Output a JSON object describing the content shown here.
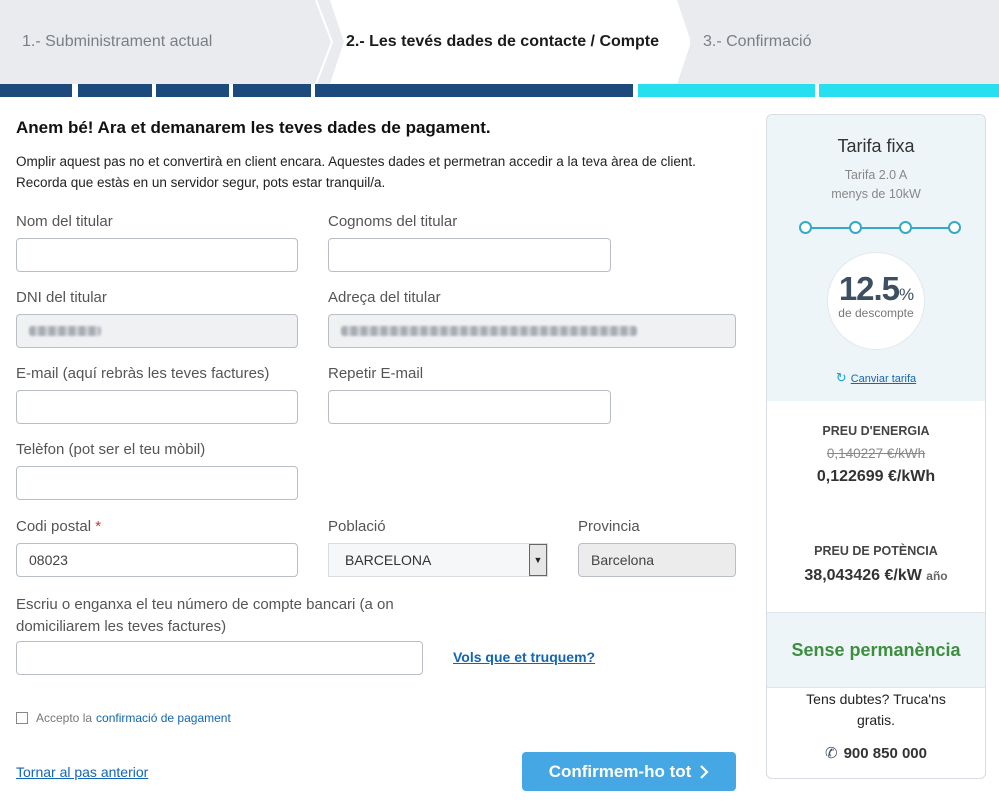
{
  "steps": [
    {
      "label": "1.- Subministrament actual"
    },
    {
      "label": "2.- Les tevés dades de contacte / Compte"
    },
    {
      "label": "3.- Confirmació"
    }
  ],
  "progress": {
    "completed_segments": 5,
    "total_segments": 7
  },
  "colors": {
    "progress_done": "#1d4a7c",
    "progress_todo": "#27dfef",
    "accent_button": "#45a7e4",
    "link": "#1266b5",
    "permanence": "#3d8f3f"
  },
  "form": {
    "title": "Anem bé! Ara et demanarem les teves dades de pagament.",
    "intro": "Omplir aquest pas no et convertirà en client encara. Aquestes dades et permetran accedir a la teva àrea de client. Recorda que estàs en un servidor segur, pots estar tranquil/a.",
    "name_label": "Nom del titular",
    "name_value": "",
    "surname_label": "Cognoms del titular",
    "surname_value": "",
    "dni_label": "DNI del titular",
    "address_label": "Adreça del titular",
    "email_label": "E-mail (aquí rebràs les teves factures)",
    "email_value": "",
    "email_repeat_label": "Repetir E-mail",
    "email_repeat_value": "",
    "phone_label": "Telèfon (pot ser el teu mòbil)",
    "phone_value": "",
    "postal_label": "Codi postal",
    "postal_required": "*",
    "postal_value": "08023",
    "town_label": "Població",
    "town_value": "BARCELONA",
    "province_label": "Provincia",
    "province_value": "Barcelona",
    "bank_label": "Escriu o enganxa el teu número de compte bancari (a on domiciliarem les teves factures)",
    "bank_value": "",
    "bank_help_link": "Vols que et truquem?",
    "accept_prefix": "Accepto la",
    "accept_link": "confirmació de pagament",
    "accept_checked": false,
    "back_link": "Tornar al pas anterior",
    "confirm_button": "Confirmem-ho tot",
    "confirm_icon": "chevron-right-icon"
  },
  "sidebar": {
    "title": "Tarifa fixa",
    "subtitle_line1": "Tarifa 2.0 A",
    "subtitle_line2": "menys de 10kW",
    "discount_value": "12.5",
    "discount_unit": "%",
    "discount_label": "de descompte",
    "change_tariff": "Canviar tarifa",
    "change_icon": "refresh-icon",
    "energy_label": "PREU D'ENERGIA",
    "energy_old": "0,140227 €/kWh",
    "energy_new": "0,122699 €/kWh",
    "power_label": "PREU DE POTÈNCIA",
    "power_value": "38,043426 €/kW",
    "power_unit": "año",
    "permanence": "Sense permanència",
    "help_text": "Tens dubtes? Truca'ns gratis.",
    "phone": "900 850 000",
    "phone_icon": "phone-icon"
  }
}
